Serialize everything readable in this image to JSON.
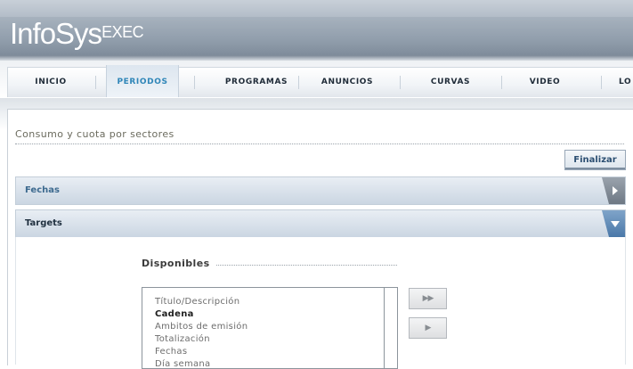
{
  "app": {
    "logo_main": "InfoSys",
    "logo_sup": "EXEC"
  },
  "nav": {
    "items": [
      {
        "label": "INICIO"
      },
      {
        "label": "PERIODOS",
        "active": true
      },
      {
        "label": "PROGRAMAS"
      },
      {
        "label": "ANUNCIOS"
      },
      {
        "label": "CURVAS"
      },
      {
        "label": "VIDEO"
      },
      {
        "label": "LO"
      }
    ]
  },
  "page": {
    "title": "Consumo y cuota por sectores",
    "finalize_label": "Finalizar"
  },
  "sections": {
    "fechas": {
      "label": "Fechas",
      "expanded": false
    },
    "targets": {
      "label": "Targets",
      "expanded": true
    }
  },
  "targets": {
    "available_label": "Disponibles",
    "items": [
      {
        "label": "Título/Descripción"
      },
      {
        "label": "Cadena",
        "selected": true
      },
      {
        "label": "Ambitos de emisión"
      },
      {
        "label": "Totalización"
      },
      {
        "label": "Fechas"
      },
      {
        "label": "Día semana"
      }
    ],
    "move_all_icon": "double-right-arrow-icon",
    "move_one_icon": "right-arrow-icon"
  },
  "colors": {
    "accent_active_nav": "#2f86b8",
    "section_label": "#2c4f72",
    "fechas_label": "#3d6a8f",
    "header_bg": "#939fad"
  }
}
